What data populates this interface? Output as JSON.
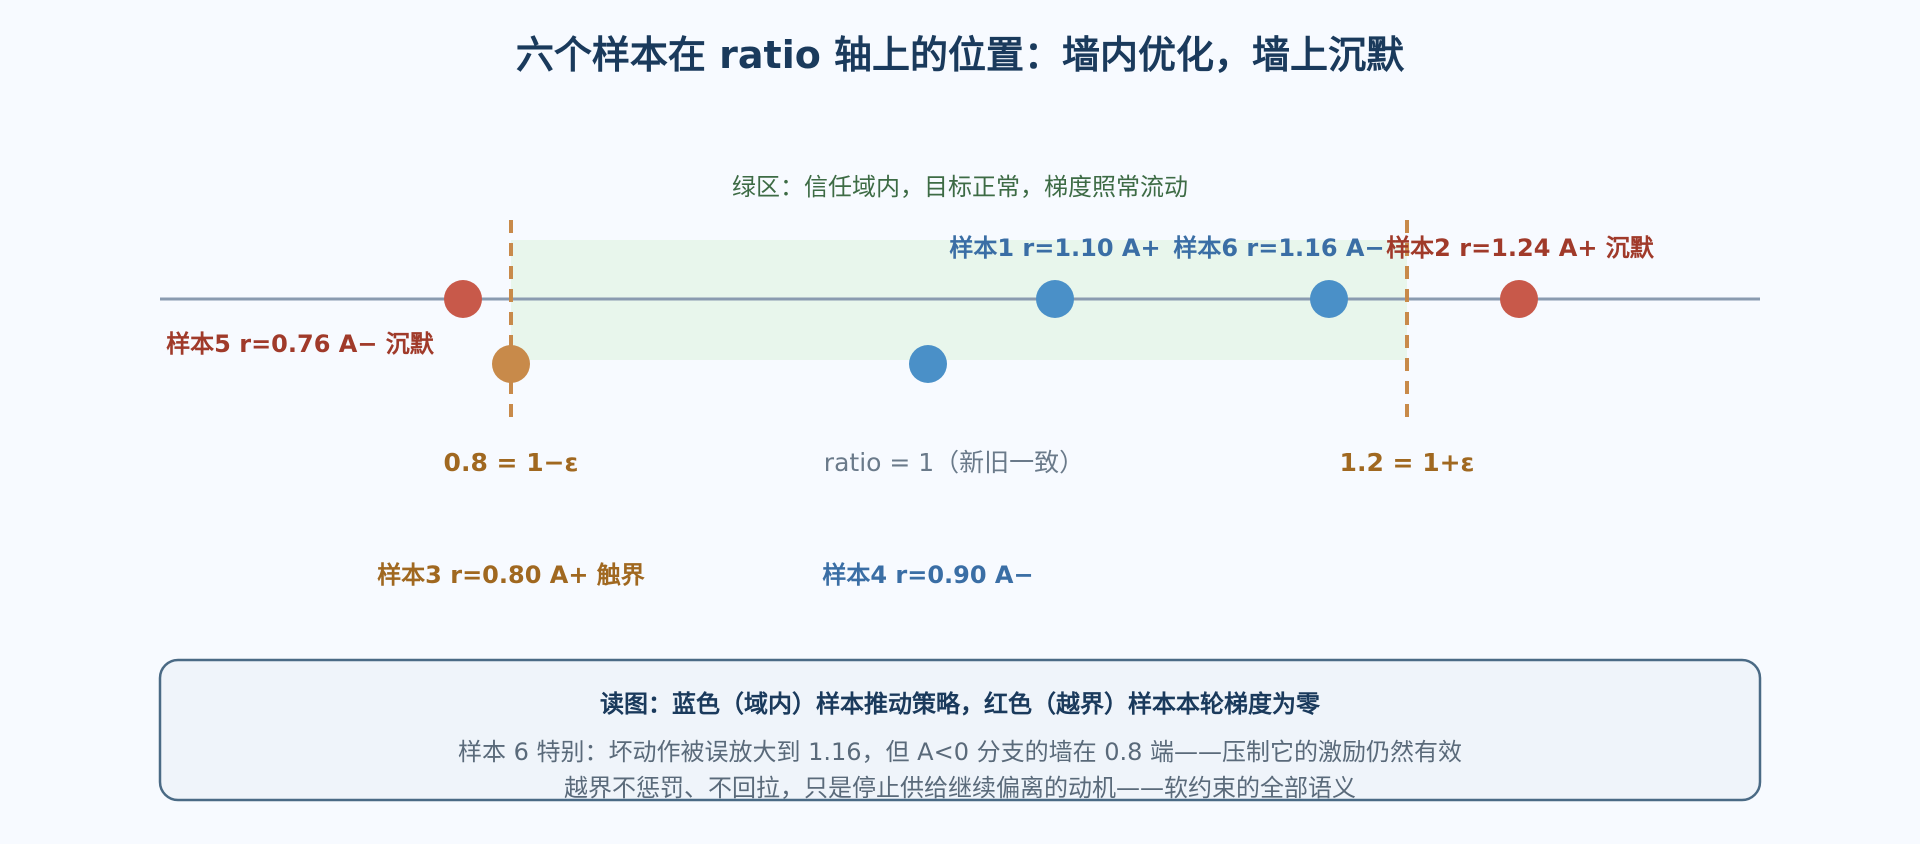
{
  "title": "六个样本在 ratio 轴上的位置：墙内优化，墙上沉默",
  "zone_label": "绿区：信任域内，目标正常，梯度照常流动",
  "axis": {
    "lower_wall_label": "0.8 = 1−ε",
    "center_label": "ratio = 1（新旧一致）",
    "upper_wall_label": "1.2 = 1+ε",
    "lower_wall": 0.8,
    "upper_wall": 1.2
  },
  "samples": [
    {
      "id": 1,
      "label": "样本1 r=1.10 A+",
      "ratio": 1.1,
      "advantage": "A+",
      "status": "in-zone",
      "color": "#4a90c8"
    },
    {
      "id": 2,
      "label": "样本2 r=1.24 A+ 沉默",
      "ratio": 1.24,
      "advantage": "A+",
      "status": "silent",
      "color": "#c8594a"
    },
    {
      "id": 3,
      "label": "样本3 r=0.80 A+ 触界",
      "ratio": 0.8,
      "advantage": "A+",
      "status": "boundary",
      "color": "#c88a4a"
    },
    {
      "id": 4,
      "label": "样本4 r=0.90 A−",
      "ratio": 0.9,
      "advantage": "A−",
      "status": "in-zone",
      "color": "#4a90c8"
    },
    {
      "id": 5,
      "label": "样本5 r=0.76 A− 沉默",
      "ratio": 0.76,
      "advantage": "A−",
      "status": "silent",
      "color": "#c8594a"
    },
    {
      "id": 6,
      "label": "样本6 r=1.16 A−",
      "ratio": 1.16,
      "advantage": "A−",
      "status": "in-zone",
      "color": "#4a90c8"
    }
  ],
  "colors": {
    "title": "#1a3a5c",
    "axis": "#8a9bb0",
    "zone_fill": "#e8f6ec",
    "zone_text": "#3d6b45",
    "wall": "#c88a4a",
    "wall_text": "#a06820",
    "blue_text": "#3a6ea5",
    "red_text": "#a03a2a",
    "note_bg": "#eff4fa",
    "note_border": "#4a6a85"
  },
  "note": {
    "heading": "读图：蓝色（域内）样本推动策略，红色（越界）样本本轮梯度为零",
    "line1": "样本 6 特别：坏动作被误放大到 1.16，但 A<0 分支的墙在 0.8 端——压制它的激励仍然有效",
    "line2": "越界不惩罚、不回拉，只是停止供给继续偏离的动机——软约束的全部语义"
  }
}
